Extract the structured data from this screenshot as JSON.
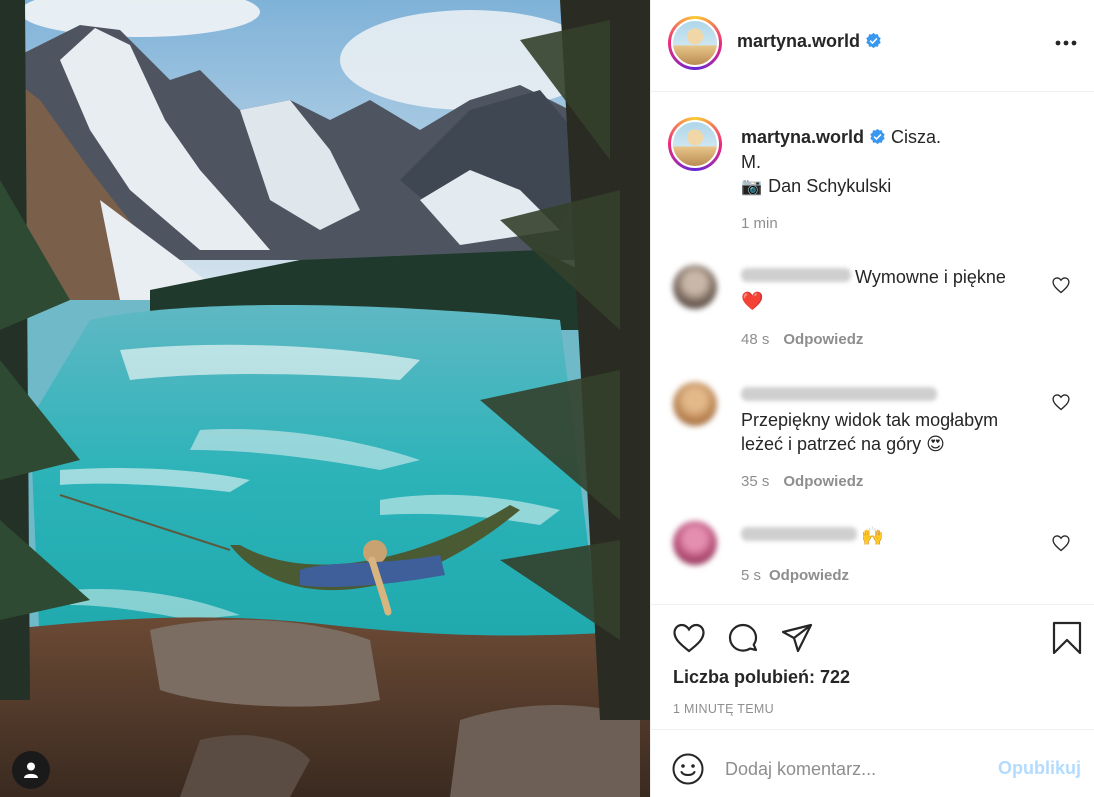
{
  "post": {
    "username": "martyna.world",
    "verified": true,
    "caption": {
      "text": "Cisza.",
      "line2": "M.",
      "line3_icon": "camera-emoji",
      "line3": "Dan Schykulski",
      "time": "1 min"
    }
  },
  "comments": [
    {
      "text": "Wymowne i piękne",
      "emoji": "❤️",
      "time": "48 s",
      "reply_label": "Odpowiedz"
    },
    {
      "text": "Przepiękny widok tak mogłabym leżeć i patrzeć na góry",
      "emoji": "😍",
      "time": "35 s",
      "reply_label": "Odpowiedz"
    },
    {
      "text": "",
      "emoji": "🙌",
      "time": "5 s",
      "reply_label": "Odpowiedz"
    }
  ],
  "actions": {
    "likes_label": "Liczba polubień: 722",
    "posted_time": "1 MINUTĘ TEMU"
  },
  "add_comment": {
    "placeholder": "Dodaj komentarz...",
    "publish_label": "Opublikuj"
  },
  "colors": {
    "verified_blue": "#3897f0",
    "publish_disabled": "#b3dbff",
    "muted_gray": "#8e8e8e",
    "text_dark": "#262626"
  }
}
